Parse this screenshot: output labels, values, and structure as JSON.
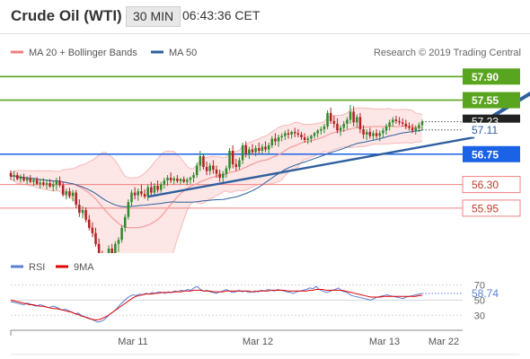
{
  "header": {
    "title": "Crude Oil (WTI)",
    "timeframe": "30 MIN",
    "time": "06:43:36 CET"
  },
  "legend": {
    "ma20_bb": "MA 20 + Bollinger Bands",
    "ma50": "MA 50",
    "copyright": "Research © 2019 Trading Central"
  },
  "rsi_legend": {
    "rsi": "RSI",
    "ma9": "9MA"
  },
  "colors": {
    "up_candle": "#2e8b2e",
    "down_candle": "#b22222",
    "resistance": "#5aa51f",
    "pivot": "#1a62e6",
    "support": "#f08080",
    "ma20": "#f4a0a0",
    "bollinger_fill": "#fde3e3",
    "ma50": "#2f5f9e",
    "trendline": "#2f5f9e",
    "arrow": "#2f5f9e",
    "rsi_line": "#5b7fd6",
    "rsi_ma": "#e00000",
    "last_price_bg": "#222222"
  },
  "chart_data": [
    {
      "type": "candlestick",
      "title": "Crude Oil (WTI)",
      "timeframe": "30 MIN",
      "x_labels": [
        "Mar 11",
        "Mar 12",
        "Mar 13",
        "Mar 22"
      ],
      "ylim": [
        55.55,
        58.05
      ],
      "levels": [
        {
          "value": 57.9,
          "label": "57.90",
          "kind": "resistance"
        },
        {
          "value": 57.55,
          "label": "57.55",
          "kind": "resistance"
        },
        {
          "value": 56.75,
          "label": "56.75",
          "kind": "pivot"
        },
        {
          "value": 56.3,
          "label": "56.30",
          "kind": "support"
        },
        {
          "value": 55.95,
          "label": "55.95",
          "kind": "support"
        }
      ],
      "last_price": "57.23",
      "ma50_value": "57.11",
      "trendline": {
        "start": {
          "index": 42,
          "price": 56.12
        },
        "end": {
          "index": 142,
          "price": 57.0
        }
      },
      "forecast_arrow": {
        "from": {
          "index": 143,
          "price": 57.18
        },
        "to": {
          "index": 165,
          "price": 57.82
        }
      },
      "candles": [
        [
          56.47,
          56.51,
          56.37,
          56.42
        ],
        [
          56.42,
          56.5,
          56.35,
          56.44
        ],
        [
          56.44,
          56.48,
          56.36,
          56.38
        ],
        [
          56.38,
          56.45,
          56.33,
          56.41
        ],
        [
          56.41,
          56.46,
          56.34,
          56.36
        ],
        [
          56.36,
          56.42,
          56.3,
          56.39
        ],
        [
          56.39,
          56.44,
          56.32,
          56.34
        ],
        [
          56.34,
          56.4,
          56.28,
          56.37
        ],
        [
          56.37,
          56.41,
          56.29,
          56.31
        ],
        [
          56.31,
          56.38,
          56.24,
          56.33
        ],
        [
          56.33,
          56.39,
          56.27,
          56.3
        ],
        [
          56.3,
          56.36,
          56.23,
          56.32
        ],
        [
          56.32,
          56.38,
          56.25,
          56.27
        ],
        [
          56.27,
          56.35,
          56.2,
          56.3
        ],
        [
          56.3,
          56.4,
          56.22,
          56.35
        ],
        [
          56.35,
          56.42,
          56.26,
          56.29
        ],
        [
          56.29,
          56.33,
          56.12,
          56.15
        ],
        [
          56.15,
          56.24,
          56.08,
          56.2
        ],
        [
          56.2,
          56.25,
          56.1,
          56.13
        ],
        [
          56.13,
          56.22,
          56.05,
          56.18
        ],
        [
          56.18,
          56.22,
          55.95,
          56.0
        ],
        [
          56.0,
          56.08,
          55.82,
          55.88
        ],
        [
          55.88,
          55.98,
          55.8,
          55.92
        ],
        [
          55.92,
          55.96,
          55.74,
          55.78
        ],
        [
          55.78,
          55.85,
          55.62,
          55.66
        ],
        [
          55.66,
          55.74,
          55.52,
          55.58
        ],
        [
          55.58,
          55.66,
          55.38,
          55.42
        ],
        [
          55.42,
          55.5,
          55.2,
          55.24
        ],
        [
          55.24,
          55.32,
          55.06,
          55.1
        ],
        [
          55.1,
          55.22,
          54.96,
          55.16
        ],
        [
          55.16,
          55.4,
          55.1,
          55.35
        ],
        [
          55.35,
          55.42,
          55.15,
          55.2
        ],
        [
          55.2,
          55.46,
          55.16,
          55.42
        ],
        [
          55.42,
          55.52,
          55.3,
          55.48
        ],
        [
          55.48,
          55.7,
          55.44,
          55.66
        ],
        [
          55.66,
          55.86,
          55.6,
          55.82
        ],
        [
          55.82,
          56.08,
          55.78,
          56.04
        ],
        [
          56.04,
          56.22,
          55.98,
          56.18
        ],
        [
          56.18,
          56.26,
          56.08,
          56.14
        ],
        [
          56.14,
          56.24,
          56.06,
          56.2
        ],
        [
          56.2,
          56.3,
          56.12,
          56.16
        ],
        [
          56.16,
          56.23,
          56.09,
          56.12
        ],
        [
          56.12,
          56.3,
          56.06,
          56.26
        ],
        [
          56.26,
          56.34,
          56.14,
          56.18
        ],
        [
          56.18,
          56.32,
          56.12,
          56.28
        ],
        [
          56.28,
          56.36,
          56.18,
          56.22
        ],
        [
          56.22,
          56.34,
          56.18,
          56.3
        ],
        [
          56.3,
          56.4,
          56.24,
          56.36
        ],
        [
          56.36,
          56.44,
          56.28,
          56.4
        ],
        [
          56.4,
          56.48,
          56.32,
          56.36
        ],
        [
          56.36,
          56.42,
          56.3,
          56.39
        ],
        [
          56.39,
          56.44,
          56.32,
          56.35
        ],
        [
          56.35,
          56.4,
          56.3,
          56.38
        ],
        [
          56.38,
          56.42,
          56.32,
          56.34
        ],
        [
          56.34,
          56.4,
          56.29,
          56.37
        ],
        [
          56.37,
          56.42,
          56.31,
          56.4
        ],
        [
          56.4,
          56.48,
          56.33,
          56.44
        ],
        [
          56.44,
          56.62,
          56.4,
          56.58
        ],
        [
          56.58,
          56.8,
          56.5,
          56.72
        ],
        [
          56.72,
          56.76,
          56.52,
          56.56
        ],
        [
          56.56,
          56.64,
          56.44,
          56.5
        ],
        [
          56.5,
          56.62,
          56.44,
          56.58
        ],
        [
          56.58,
          56.66,
          56.46,
          56.52
        ],
        [
          56.52,
          56.58,
          56.4,
          56.46
        ],
        [
          56.46,
          56.52,
          56.34,
          56.4
        ],
        [
          56.4,
          56.5,
          56.32,
          56.46
        ],
        [
          56.46,
          56.58,
          56.4,
          56.54
        ],
        [
          56.54,
          56.84,
          56.5,
          56.8
        ],
        [
          56.8,
          56.88,
          56.54,
          56.6
        ],
        [
          56.6,
          56.68,
          56.5,
          56.56
        ],
        [
          56.56,
          56.7,
          56.52,
          56.66
        ],
        [
          56.66,
          56.92,
          56.6,
          56.88
        ],
        [
          56.88,
          56.94,
          56.7,
          56.76
        ],
        [
          56.76,
          56.86,
          56.68,
          56.82
        ],
        [
          56.82,
          56.9,
          56.74,
          56.78
        ],
        [
          56.78,
          56.88,
          56.72,
          56.84
        ],
        [
          56.84,
          56.92,
          56.76,
          56.8
        ],
        [
          56.8,
          56.9,
          56.74,
          56.86
        ],
        [
          56.86,
          56.94,
          56.78,
          56.82
        ],
        [
          56.82,
          56.92,
          56.76,
          56.88
        ],
        [
          56.88,
          57.02,
          56.84,
          56.98
        ],
        [
          56.98,
          57.06,
          56.88,
          56.94
        ],
        [
          56.94,
          57.04,
          56.86,
          57.0
        ],
        [
          57.0,
          57.06,
          56.94,
          57.02
        ],
        [
          57.02,
          57.1,
          56.96,
          57.06
        ],
        [
          57.06,
          57.12,
          56.98,
          57.04
        ],
        [
          57.04,
          57.1,
          56.98,
          57.08
        ],
        [
          57.08,
          57.14,
          57.0,
          57.06
        ],
        [
          57.06,
          57.12,
          57.0,
          57.04
        ],
        [
          57.04,
          57.08,
          56.96,
          57.0
        ],
        [
          57.0,
          57.06,
          56.92,
          56.96
        ],
        [
          56.96,
          57.02,
          56.9,
          56.98
        ],
        [
          56.98,
          57.04,
          56.92,
          57.02
        ],
        [
          57.02,
          57.08,
          56.98,
          57.06
        ],
        [
          57.06,
          57.12,
          57.0,
          57.1
        ],
        [
          57.1,
          57.16,
          57.04,
          57.12
        ],
        [
          57.12,
          57.2,
          57.06,
          57.16
        ],
        [
          57.16,
          57.4,
          57.12,
          57.36
        ],
        [
          57.36,
          57.44,
          57.2,
          57.24
        ],
        [
          57.24,
          57.32,
          57.14,
          57.2
        ],
        [
          57.2,
          57.28,
          57.06,
          57.1
        ],
        [
          57.1,
          57.18,
          57.02,
          57.14
        ],
        [
          57.14,
          57.24,
          57.08,
          57.2
        ],
        [
          57.2,
          57.3,
          57.12,
          57.26
        ],
        [
          57.26,
          57.48,
          57.2,
          57.38
        ],
        [
          57.38,
          57.46,
          57.16,
          57.22
        ],
        [
          57.22,
          57.34,
          57.14,
          57.3
        ],
        [
          57.3,
          57.36,
          57.06,
          57.12
        ],
        [
          57.12,
          57.18,
          56.98,
          57.04
        ],
        [
          57.04,
          57.12,
          56.96,
          57.08
        ],
        [
          57.08,
          57.14,
          56.98,
          57.02
        ],
        [
          57.02,
          57.1,
          56.96,
          57.06
        ],
        [
          57.06,
          57.12,
          56.98,
          57.02
        ],
        [
          57.02,
          57.1,
          56.94,
          57.06
        ],
        [
          57.06,
          57.14,
          57.0,
          57.1
        ],
        [
          57.1,
          57.2,
          57.04,
          57.16
        ],
        [
          57.16,
          57.26,
          57.1,
          57.22
        ],
        [
          57.22,
          57.3,
          57.16,
          57.26
        ],
        [
          57.26,
          57.32,
          57.2,
          57.24
        ],
        [
          57.24,
          57.3,
          57.18,
          57.22
        ],
        [
          57.22,
          57.28,
          57.16,
          57.2
        ],
        [
          57.2,
          57.26,
          57.12,
          57.16
        ],
        [
          57.16,
          57.22,
          57.1,
          57.14
        ],
        [
          57.14,
          57.2,
          57.06,
          57.1
        ],
        [
          57.1,
          57.18,
          57.04,
          57.14
        ],
        [
          57.14,
          57.22,
          57.08,
          57.18
        ],
        [
          57.18,
          57.26,
          57.12,
          57.23
        ]
      ]
    },
    {
      "type": "line",
      "title": "RSI",
      "ylim": [
        15,
        80
      ],
      "y_ticks": [
        70,
        50,
        30
      ],
      "current_value": "58.74",
      "series": [
        {
          "name": "RSI",
          "values": [
            48,
            47,
            46,
            45,
            44,
            46,
            45,
            43,
            42,
            44,
            43,
            41,
            40,
            42,
            41,
            39,
            37,
            38,
            36,
            34,
            32,
            33,
            30,
            28,
            27,
            25,
            23,
            21,
            22,
            24,
            28,
            32,
            35,
            39,
            44,
            48,
            52,
            55,
            57,
            56,
            58,
            57,
            59,
            58,
            60,
            59,
            61,
            60,
            59,
            61,
            60,
            62,
            61,
            63,
            62,
            64,
            63,
            66,
            68,
            64,
            62,
            63,
            61,
            60,
            59,
            61,
            62,
            64,
            62,
            60,
            61,
            63,
            61,
            62,
            60,
            61,
            62,
            61,
            63,
            62,
            64,
            63,
            62,
            64,
            63,
            62,
            61,
            60,
            59,
            61,
            62,
            63,
            64,
            66,
            65,
            68,
            64,
            62,
            60,
            61,
            63,
            64,
            66,
            62,
            61,
            59,
            56,
            55,
            54,
            53,
            52,
            51,
            50,
            52,
            54,
            55,
            56,
            57,
            56,
            55,
            54,
            53,
            52,
            54,
            55,
            56,
            57,
            58,
            58.74
          ]
        },
        {
          "name": "9MA",
          "values": [
            50,
            49,
            48,
            47,
            46,
            45,
            44,
            44,
            43,
            42,
            42,
            41,
            40,
            39,
            39,
            38,
            37,
            36,
            35,
            34,
            32,
            31,
            29,
            28,
            26,
            25,
            24,
            24,
            25,
            27,
            29,
            32,
            35,
            38,
            41,
            44,
            47,
            50,
            53,
            55,
            56,
            57,
            58,
            58,
            58,
            59,
            59,
            60,
            60,
            60,
            60,
            61,
            61,
            61,
            62,
            62,
            62,
            63,
            63,
            63,
            62,
            62,
            62,
            61,
            61,
            61,
            61,
            62,
            62,
            62,
            62,
            62,
            62,
            62,
            62,
            61,
            61,
            62,
            62,
            62,
            62,
            63,
            63,
            63,
            63,
            63,
            62,
            62,
            62,
            62,
            62,
            62,
            62,
            63,
            63,
            64,
            64,
            64,
            63,
            63,
            63,
            63,
            63,
            63,
            62,
            61,
            60,
            59,
            58,
            57,
            56,
            55,
            54,
            54,
            54,
            54,
            55,
            55,
            55,
            55,
            55,
            55,
            55,
            55,
            55,
            55,
            55,
            56,
            56
          ]
        }
      ]
    }
  ]
}
